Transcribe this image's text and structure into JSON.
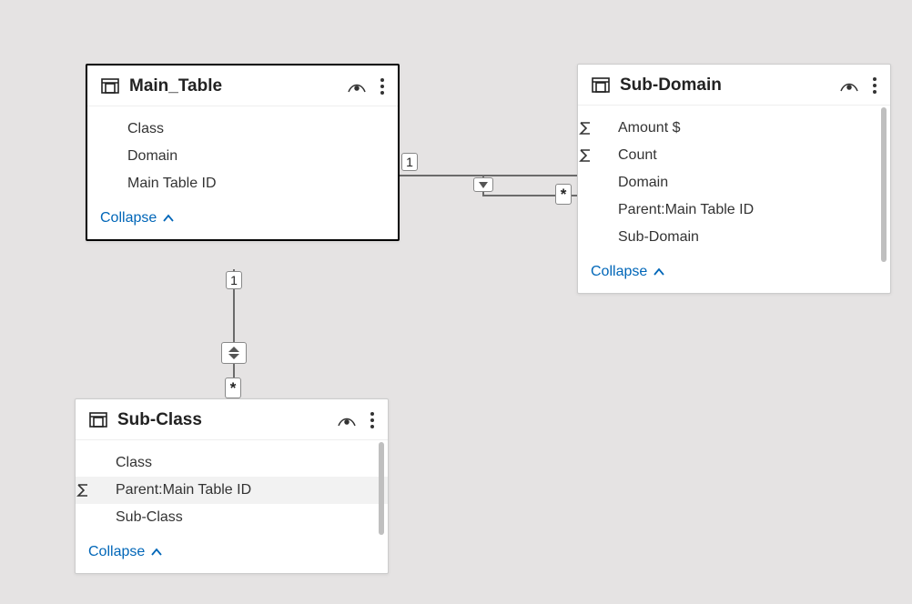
{
  "tables": {
    "main": {
      "title": "Main_Table",
      "fields": [
        "Class",
        "Domain",
        "Main Table ID"
      ],
      "collapse": "Collapse"
    },
    "subdomain": {
      "title": "Sub-Domain",
      "fields": [
        "Amount $",
        "Count",
        "Domain",
        "Parent:Main Table ID",
        "Sub-Domain"
      ],
      "collapse": "Collapse"
    },
    "subclass": {
      "title": "Sub-Class",
      "fields": [
        "Class",
        "Parent:Main Table ID",
        "Sub-Class"
      ],
      "collapse": "Collapse"
    }
  },
  "relations": {
    "main_to_subdomain": {
      "from": "1",
      "to": "*"
    },
    "main_to_subclass": {
      "from": "1",
      "to": "*"
    }
  }
}
